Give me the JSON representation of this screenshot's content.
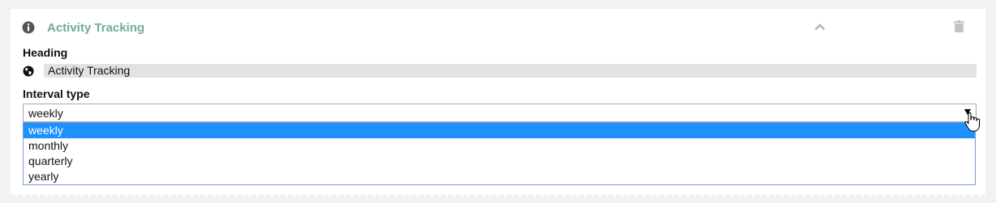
{
  "panel": {
    "title": "Activity Tracking",
    "title_color": "#6fae8f",
    "icons": {
      "info": "info-circle-icon",
      "collapse": "chevron-up-icon",
      "delete": "trash-icon"
    }
  },
  "heading_field": {
    "label": "Heading",
    "value": "Activity Tracking",
    "icon": "globe-icon"
  },
  "interval_field": {
    "label": "Interval type",
    "selected": "weekly",
    "options": [
      {
        "label": "weekly",
        "selected": true
      },
      {
        "label": "monthly",
        "selected": false
      },
      {
        "label": "quarterly",
        "selected": false
      },
      {
        "label": "yearly",
        "selected": false
      }
    ],
    "highlight_color": "#1e90ff"
  }
}
